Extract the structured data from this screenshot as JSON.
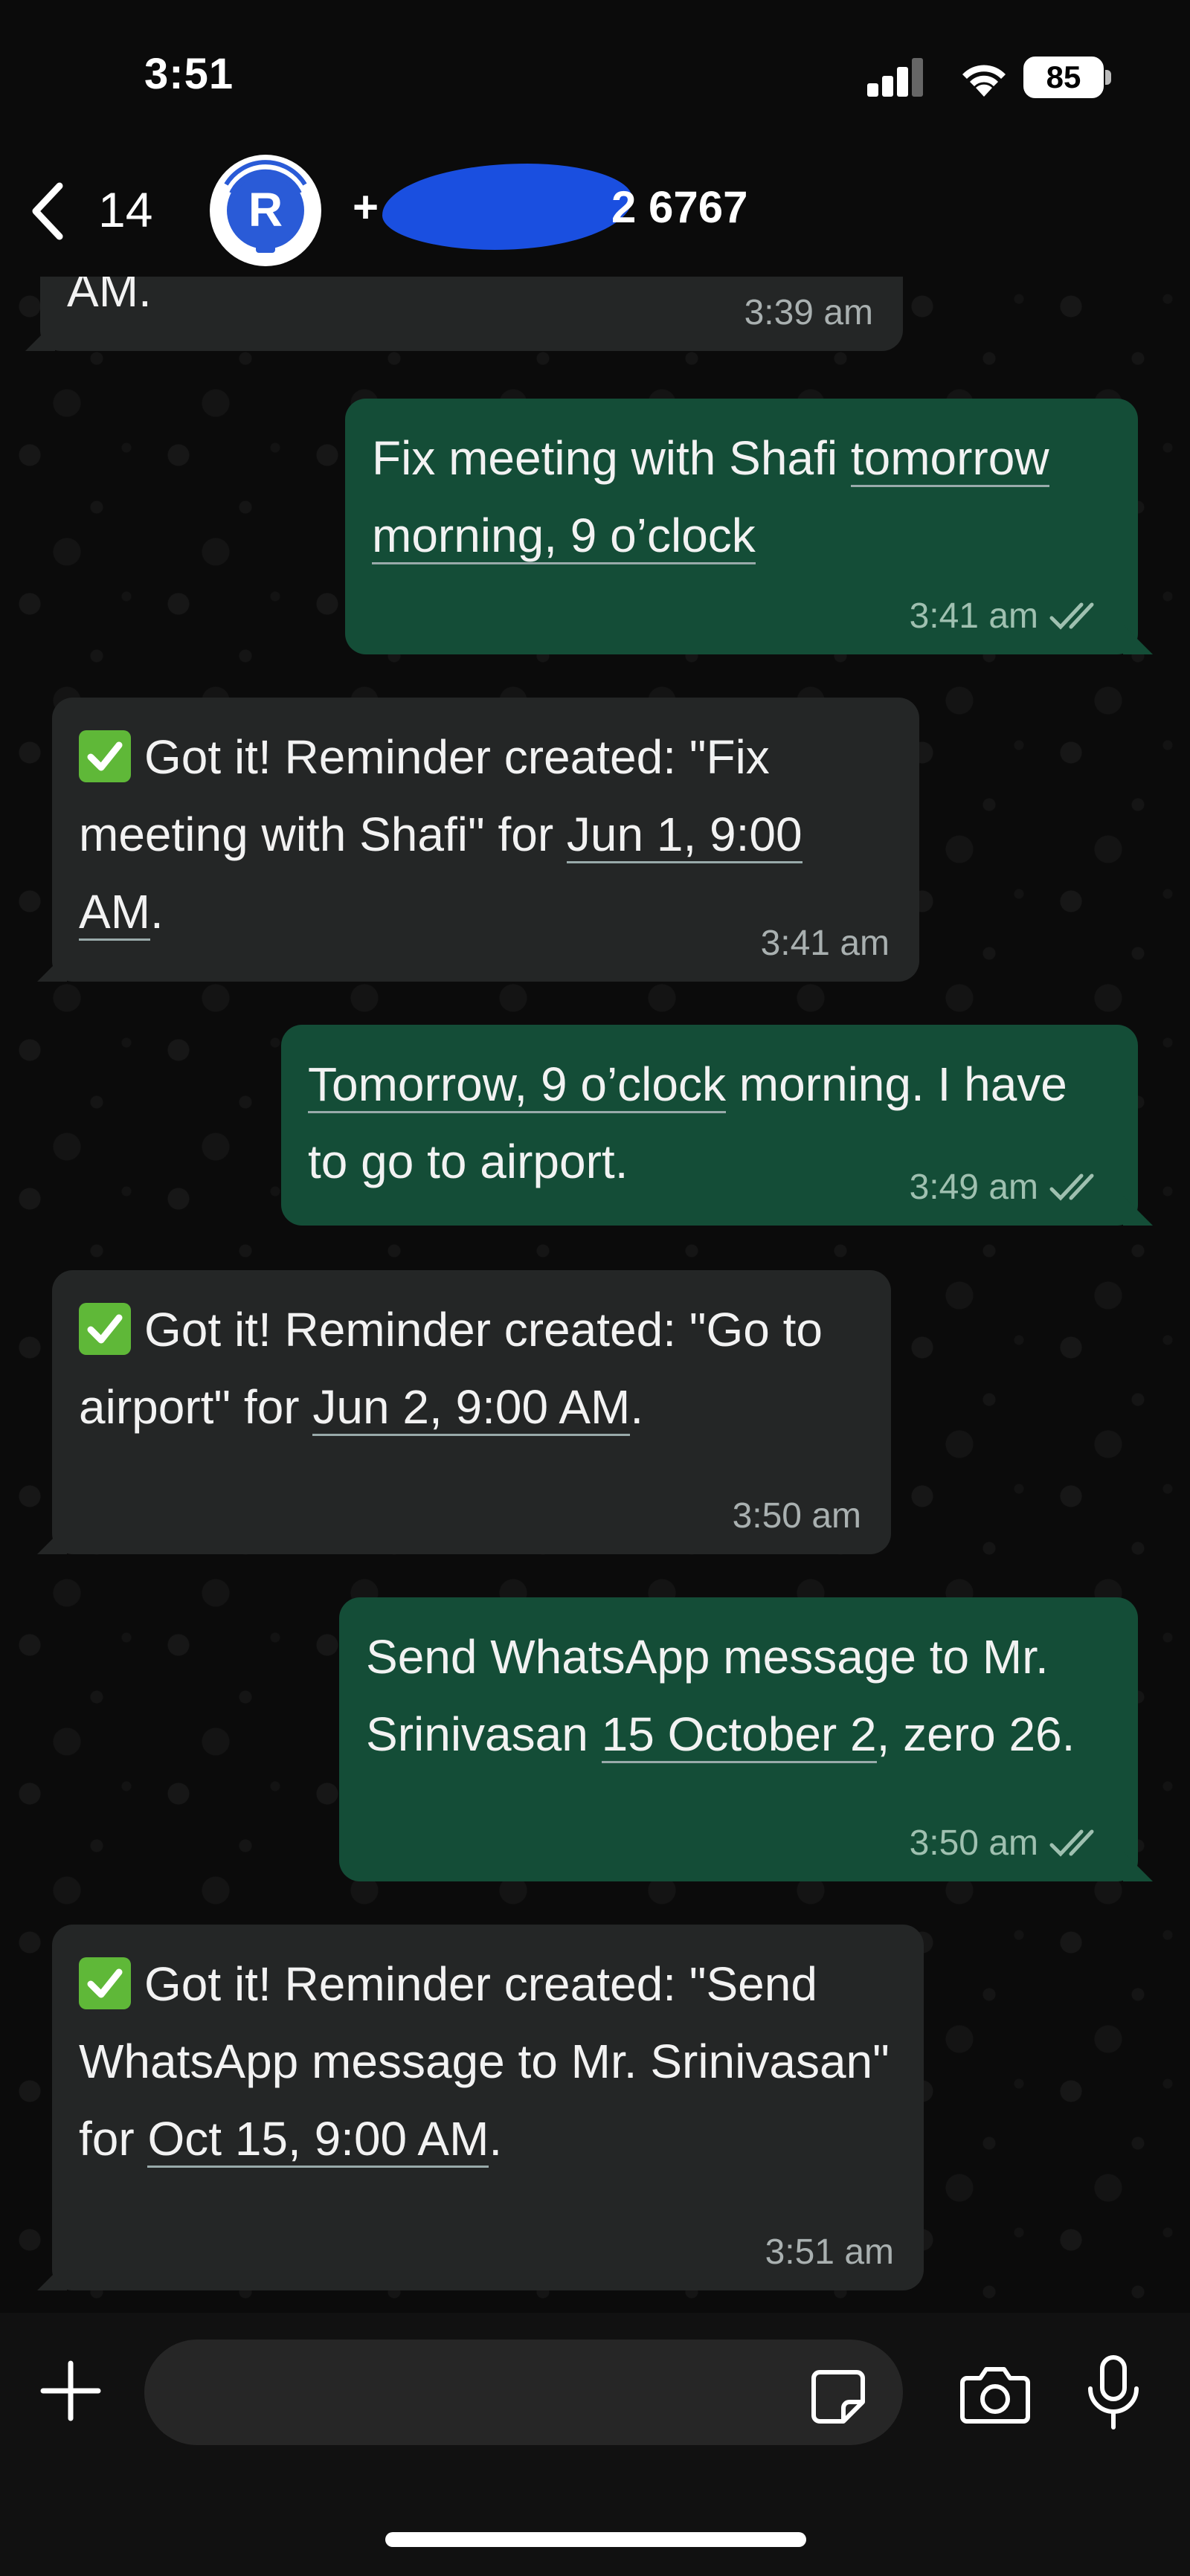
{
  "status_bar": {
    "time": "3:51",
    "battery": "85"
  },
  "header": {
    "back_count": "14",
    "contact_prefix": "+",
    "contact_suffix": "2 6767"
  },
  "messages": [
    {
      "direction": "in",
      "text_html": "AM.",
      "time": "3:39 am"
    },
    {
      "direction": "out",
      "text_html": "Fix meeting with Shafi <u>tomorrow morning, 9 o’clock</u>",
      "time": "3:41 am"
    },
    {
      "direction": "in",
      "text_html": "Got it! Reminder created: \"Fix meeting with Shafi\" for <u>Jun 1, 9:00 AM</u>.",
      "time": "3:41 am"
    },
    {
      "direction": "out",
      "text_html": "<u>Tomorrow, 9 o’clock</u> morning. I have to go to airport.",
      "time": "3:49 am"
    },
    {
      "direction": "in",
      "text_html": "Got it! Reminder created: \"Go to airport\" for <u>Jun 2, 9:00 AM</u>.",
      "time": "3:50 am"
    },
    {
      "direction": "out",
      "text_html": "Send WhatsApp message to Mr. Srinivasan <u>15 October 2</u>, zero 26.",
      "time": "3:50 am"
    },
    {
      "direction": "in",
      "text_html": "Got it! Reminder created: \"Send WhatsApp message to Mr. Srinivasan\" for <u>Oct 15, 9:00 AM</u>.",
      "time": "3:51 am"
    }
  ],
  "colors": {
    "incoming_bubble": "#242626",
    "outgoing_bubble": "#144d37",
    "redaction": "#1a4fe0"
  },
  "icons": [
    "back-chevron-icon",
    "avatar-logo",
    "check-emoji-icon",
    "double-tick-icon",
    "plus-icon",
    "sticker-icon",
    "camera-icon",
    "mic-icon"
  ]
}
